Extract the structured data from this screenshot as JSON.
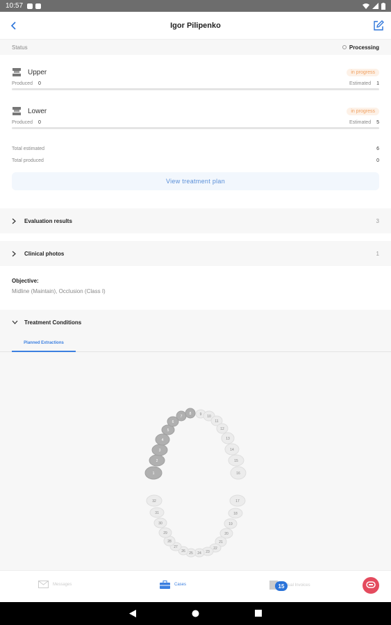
{
  "statusbar": {
    "time": "10:57"
  },
  "header": {
    "title": "Igor Pilipenko"
  },
  "status": {
    "label": "Status",
    "value": "Processing"
  },
  "jaws": [
    {
      "name": "Upper",
      "badge": "in progress",
      "produced_label": "Produced",
      "produced": "0",
      "estimated_label": "Estimated",
      "estimated": "1"
    },
    {
      "name": "Lower",
      "badge": "in progress",
      "produced_label": "Produced",
      "produced": "0",
      "estimated_label": "Estimated",
      "estimated": "5"
    }
  ],
  "totals": {
    "estimated_label": "Total estimated",
    "estimated": "6",
    "produced_label": "Total produced",
    "produced": "0"
  },
  "view_plan_label": "View treatment plan",
  "sections": {
    "evaluation": {
      "label": "Evaluation results",
      "count": "3"
    },
    "photos": {
      "label": "Clinical photos",
      "count": "1"
    }
  },
  "objective": {
    "label": "Objective:",
    "text": "Midline (Maintain), Occlusion (Class I)"
  },
  "treatment": {
    "label": "Treatment Conditions",
    "tab": "Planned Extractions"
  },
  "teeth_numbers": [
    "1",
    "2",
    "3",
    "4",
    "5",
    "6",
    "7",
    "8",
    "9",
    "10",
    "11",
    "12",
    "13",
    "14",
    "15",
    "16",
    "17",
    "18",
    "19",
    "20",
    "21",
    "22",
    "23",
    "24",
    "25",
    "26",
    "27",
    "28",
    "29",
    "30",
    "31",
    "32"
  ],
  "bottom_nav": {
    "messages": "Messages",
    "cases": "Cases",
    "third": "Virtual Invoices",
    "badge": "15"
  },
  "colors": {
    "accent": "#3b7fe0",
    "badge_text": "#f0a060",
    "fab": "#e44b5e"
  }
}
